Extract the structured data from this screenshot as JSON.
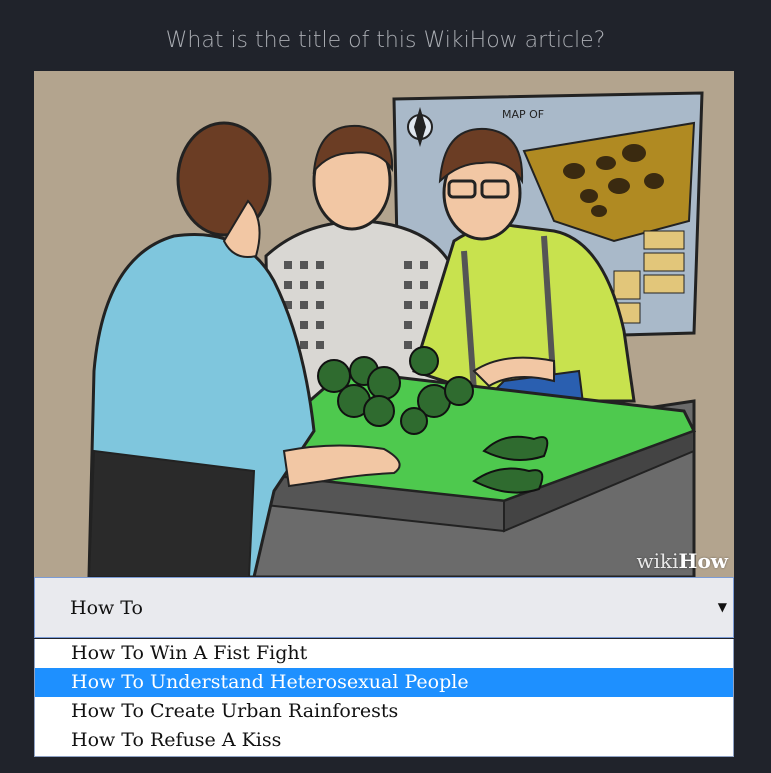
{
  "question": "What is the title of this WikiHow article?",
  "image": {
    "map_label": "MAP OF",
    "watermark_wiki": "wiki",
    "watermark_how": "How"
  },
  "select": {
    "value": "How To",
    "arrow_icon": "triangle-down-icon"
  },
  "options": [
    {
      "label": "How To Win A Fist Fight",
      "selected": false
    },
    {
      "label": "How To Understand Heterosexual People",
      "selected": true
    },
    {
      "label": "How To Create Urban Rainforests",
      "selected": false
    },
    {
      "label": "How To Refuse A Kiss",
      "selected": false
    }
  ],
  "colors": {
    "background": "#20232b",
    "highlight": "#1e90ff",
    "table_green": "#4ec94e"
  }
}
